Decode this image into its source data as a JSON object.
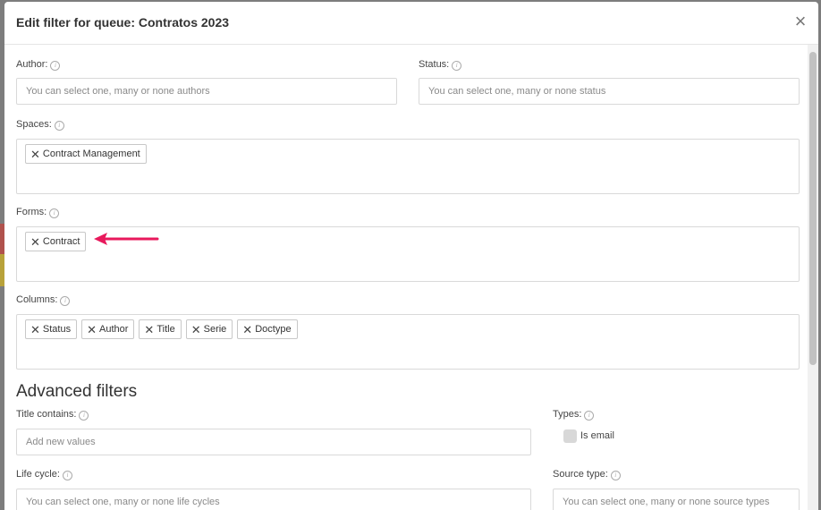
{
  "dialog": {
    "title": "Edit filter for queue: Contratos 2023",
    "close_glyph": "×"
  },
  "fields": {
    "author": {
      "label": "Author:",
      "placeholder": "You can select one, many or none authors"
    },
    "status": {
      "label": "Status:",
      "placeholder": "You can select one, many or none status"
    },
    "spaces": {
      "label": "Spaces:",
      "tags": [
        "Contract Management"
      ]
    },
    "forms": {
      "label": "Forms:",
      "tags": [
        "Contract"
      ]
    },
    "columns": {
      "label": "Columns:",
      "tags": [
        "Status",
        "Author",
        "Title",
        "Serie",
        "Doctype"
      ]
    }
  },
  "advanced": {
    "title": "Advanced filters",
    "title_contains": {
      "label": "Title contains:",
      "placeholder": "Add new values"
    },
    "types": {
      "label": "Types:",
      "option": "Is email"
    },
    "life_cycle": {
      "label": "Life cycle:",
      "placeholder": "You can select one, many or none life cycles"
    },
    "source_type": {
      "label": "Source type:",
      "placeholder": "You can select one, many or none source types"
    }
  },
  "icons": {
    "info": "ⓘ",
    "tag_remove": "✕"
  },
  "colors": {
    "arrow": "#e8195c"
  }
}
